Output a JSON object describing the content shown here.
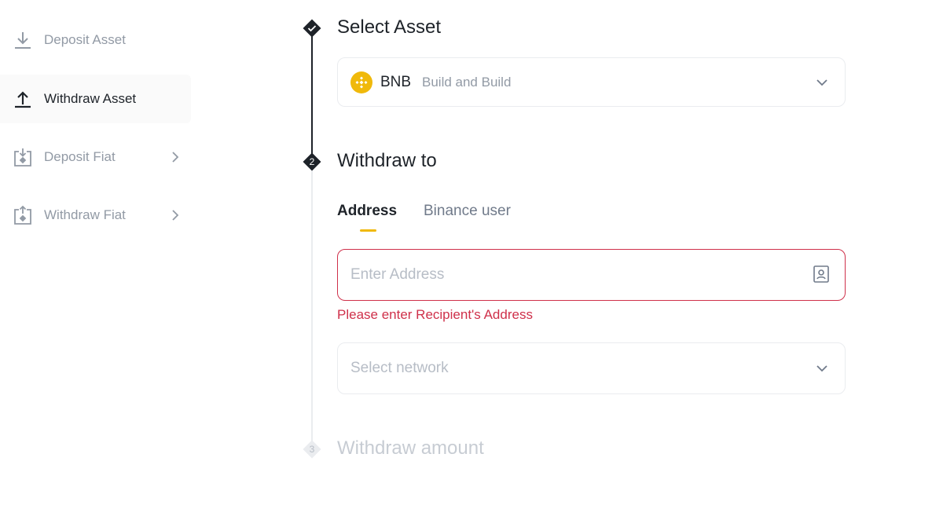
{
  "sidebar": {
    "items": [
      {
        "label": "Deposit Asset",
        "icon": "download-icon",
        "active": false
      },
      {
        "label": "Withdraw Asset",
        "icon": "upload-icon",
        "active": true
      },
      {
        "label": "Deposit Fiat",
        "icon": "deposit-fiat-icon",
        "active": false
      },
      {
        "label": "Withdraw Fiat",
        "icon": "withdraw-fiat-icon",
        "active": false
      }
    ]
  },
  "steps": {
    "step1": {
      "title": "Select Asset",
      "status": "completed"
    },
    "step2": {
      "number": "2",
      "title": "Withdraw to",
      "status": "active"
    },
    "step3": {
      "number": "3",
      "title": "Withdraw amount",
      "status": "pending"
    }
  },
  "asset": {
    "symbol": "BNB",
    "name": "Build and Build",
    "icon": "bnb-coin-icon"
  },
  "tabs": [
    {
      "label": "Address",
      "active": true
    },
    {
      "label": "Binance user",
      "active": false
    }
  ],
  "address": {
    "placeholder": "Enter Address",
    "value": "",
    "error": "Please enter Recipient's Address"
  },
  "network": {
    "placeholder": "Select network"
  },
  "colors": {
    "accent": "#f0b90b",
    "error": "#cf304a",
    "text_primary": "#1e2329",
    "text_muted": "#929aa5",
    "placeholder": "#b7bdc6"
  }
}
